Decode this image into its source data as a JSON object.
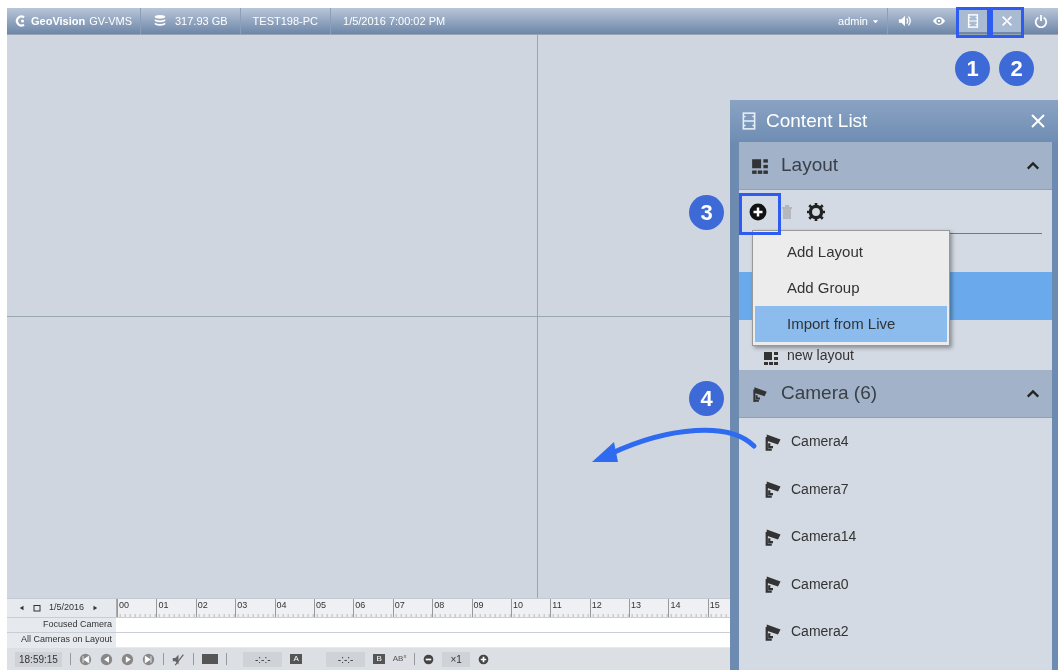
{
  "top_bar": {
    "logo": "GeoVision",
    "product": "GV-VMS",
    "storage": "317.93 GB",
    "computer": "TEST198-PC",
    "datetime": "1/5/2016 7:00:02 PM",
    "user": "admin",
    "buttons": [
      {
        "kind": "volume",
        "selected": false
      },
      {
        "kind": "eye",
        "selected": false
      },
      {
        "kind": "content-list",
        "selected": true
      },
      {
        "kind": "tools",
        "selected": true
      },
      {
        "kind": "power",
        "selected": false
      }
    ]
  },
  "content_list": {
    "title": "Content List",
    "layout_section": {
      "title": "Layout",
      "expanded": true,
      "items": [
        {
          "selected": false
        },
        {
          "selected": true
        },
        {
          "label": "new layout",
          "selected": false
        }
      ]
    },
    "add_menu": [
      {
        "label": "Add Layout",
        "selected": false
      },
      {
        "label": "Add Group",
        "selected": false
      },
      {
        "label": "Import from Live",
        "selected": true
      }
    ],
    "camera_section": {
      "title": "Camera (6)",
      "expanded": true,
      "items": [
        {
          "label": "Camera4"
        },
        {
          "label": "Camera7"
        },
        {
          "label": "Camera14"
        },
        {
          "label": "Camera0"
        },
        {
          "label": "Camera2"
        }
      ]
    }
  },
  "annotations": [
    {
      "label": "1"
    },
    {
      "label": "2"
    },
    {
      "label": "3"
    },
    {
      "label": "4"
    }
  ],
  "timeline": {
    "date": "1/5/2016",
    "hours": [
      "00",
      "01",
      "02",
      "03",
      "04",
      "05",
      "06",
      "07",
      "08",
      "09",
      "10",
      "11",
      "12",
      "13",
      "14",
      "15"
    ],
    "rows": [
      "Focused Camera",
      "All Cameras on Layout"
    ]
  },
  "playback": {
    "time": "18:59:15",
    "marker_a_time": "-:-:-",
    "marker_a": "A",
    "marker_b_time": "-:-:-",
    "marker_b": "B",
    "ab_repeat": "AB$^{x}$",
    "speed": "×1"
  }
}
